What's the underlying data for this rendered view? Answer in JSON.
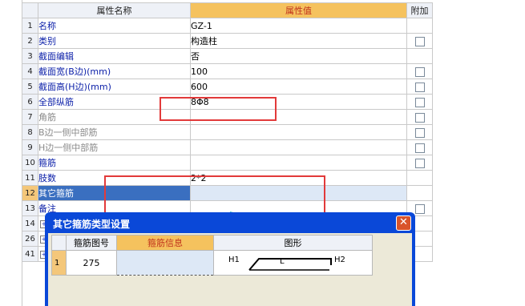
{
  "grid": {
    "headers": {
      "name": "属性名称",
      "value": "属性值",
      "extra": "附加"
    },
    "rows": [
      {
        "num": "1",
        "name": "名称",
        "value": "GZ-1",
        "nameColor": "blue",
        "checkbox": false
      },
      {
        "num": "2",
        "name": "类别",
        "value": "构造柱",
        "nameColor": "blue",
        "checkbox": true
      },
      {
        "num": "3",
        "name": "截面编辑",
        "value": "否",
        "nameColor": "blue",
        "checkbox": false
      },
      {
        "num": "4",
        "name": "截面宽(B边)(mm)",
        "value": "100",
        "nameColor": "blue",
        "checkbox": true
      },
      {
        "num": "5",
        "name": "截面高(H边)(mm)",
        "value": "600",
        "nameColor": "blue",
        "checkbox": true
      },
      {
        "num": "6",
        "name": "全部纵筋",
        "value": "8Φ8",
        "nameColor": "blue",
        "checkbox": true
      },
      {
        "num": "7",
        "name": "角筋",
        "value": "",
        "nameColor": "gray",
        "checkbox": true
      },
      {
        "num": "8",
        "name": "B边一侧中部筋",
        "value": "",
        "nameColor": "gray",
        "checkbox": true
      },
      {
        "num": "9",
        "name": "H边一侧中部筋",
        "value": "",
        "nameColor": "gray",
        "checkbox": true
      },
      {
        "num": "10",
        "name": "箍筋",
        "value": "",
        "nameColor": "blue",
        "checkbox": true
      },
      {
        "num": "11",
        "name": "肢数",
        "value": "2*2",
        "nameColor": "blue",
        "checkbox": false
      },
      {
        "num": "12",
        "name": "其它箍筋",
        "value": "",
        "nameColor": "sel",
        "checkbox": false
      },
      {
        "num": "13",
        "name": "备注",
        "value": "",
        "nameColor": "blue",
        "checkbox": true
      },
      {
        "num": "14",
        "name": "",
        "value": "",
        "nameColor": "blue",
        "checkbox": false,
        "expand": true
      },
      {
        "num": "26",
        "name": "",
        "value": "",
        "nameColor": "blue",
        "checkbox": false,
        "expand": true
      },
      {
        "num": "41",
        "name": "",
        "value": "",
        "nameColor": "blue",
        "checkbox": false,
        "expand": true
      }
    ]
  },
  "dialog": {
    "title": "其它箍筋类型设置",
    "close": "✕",
    "headers": {
      "img": "箍筋图号",
      "info": "箍筋信息",
      "shape": "图形"
    },
    "row": {
      "num": "1",
      "img": "275",
      "info": "",
      "h1": "H1",
      "l": "L",
      "h2": "H2"
    }
  },
  "colors": {
    "accent_header": "#f5c25e",
    "selection": "#3a6fc0",
    "highlight_box": "#e23a3a",
    "dialog_frame": "#0a48d8",
    "arrow": "#3fc1c9"
  }
}
